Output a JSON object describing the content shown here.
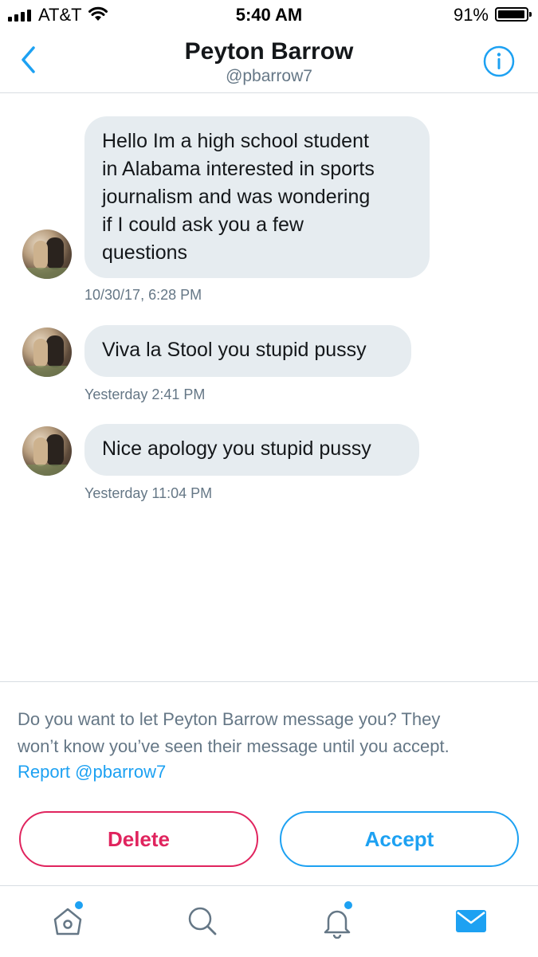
{
  "status_bar": {
    "carrier": "AT&T",
    "time": "5:40 AM",
    "battery": "91%",
    "battery_level": 0.91
  },
  "header": {
    "title": "Peyton Barrow",
    "handle": "@pbarrow7",
    "back_icon": "chevron-left-icon",
    "info_icon": "info-icon"
  },
  "messages": [
    {
      "lines": [
        "Hello Im a high school student",
        "in Alabama interested in sports",
        "journalism and was wondering",
        "if I could ask you a few",
        "questions"
      ],
      "timestamp": "10/30/17, 6:28 PM"
    },
    {
      "lines": [
        "Viva la Stool you stupid pussy"
      ],
      "timestamp": "Yesterday 2:41 PM"
    },
    {
      "lines": [
        "Nice apology you stupid pussy"
      ],
      "timestamp": "Yesterday 11:04 PM"
    }
  ],
  "request": {
    "line1": "Do you want to let Peyton Barrow message you? They",
    "line2": "won’t know you’ve seen their message until you accept.",
    "report_link": "Report @pbarrow7",
    "delete_label": "Delete",
    "accept_label": "Accept"
  },
  "tabbar": {
    "items": [
      "home-icon",
      "search-icon",
      "notifications-icon",
      "messages-icon"
    ]
  },
  "colors": {
    "accent": "#1da1f2",
    "danger": "#e0245e",
    "bubble": "#e6ecf0",
    "secondary_text": "#657786"
  }
}
